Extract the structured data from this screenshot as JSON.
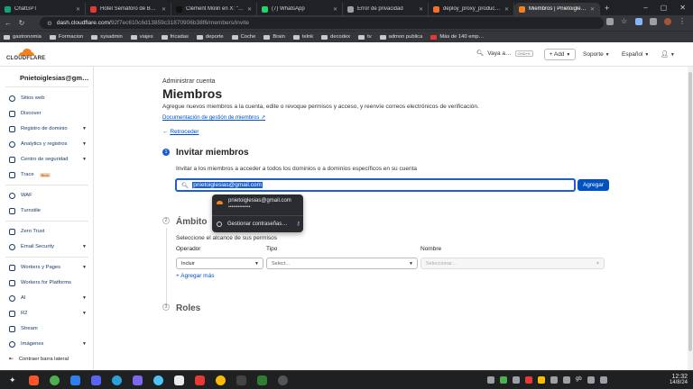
{
  "browser": {
    "tabs": [
      {
        "label": "ChatGPT",
        "color": "#10a37f"
      },
      {
        "label": "Hotel Semáforo de Bares",
        "color": "#e53935"
      },
      {
        "label": "Clément Molin en X: \"~Per…",
        "color": "#111111"
      },
      {
        "label": "(7) WhatsApp",
        "color": "#25d366"
      },
      {
        "label": "Error de privacidad",
        "color": "#9aa0a6"
      },
      {
        "label": "deploy_proxy_production",
        "color": "#fc6d26"
      },
      {
        "label": "Miembros | Pnietoiglesias…",
        "color": "#f48120",
        "active": true
      }
    ],
    "new_tab": "+",
    "url_host": "dash.cloudflare.com/",
    "url_path": "92f7ec610c6d13859c31870906b38f6/members/invite",
    "bookmarks": [
      "gastronomia",
      "Formacion",
      "sysadmin",
      "viajes",
      "fricadas",
      "deporte",
      "Coche",
      "Brain",
      "telnk",
      "decodex",
      "tv",
      "admon publica",
      "Más de 140 emp…"
    ]
  },
  "header": {
    "logo_text": "CLOUDFLARE",
    "search_label": "Vaya a…",
    "search_shortcut": "CMD+K",
    "add_label": "+ Add",
    "support_label": "Soporte",
    "language_label": "Español"
  },
  "sidebar": {
    "account_name": "Pnietoiglesias@gm…",
    "items": [
      {
        "label": "Sitios web",
        "chevron": false
      },
      {
        "label": "Discover",
        "chevron": false
      },
      {
        "label": "Registro de dominio",
        "chevron": true
      },
      {
        "label": "Analytics y registros",
        "chevron": true
      },
      {
        "label": "Centro de seguridad",
        "chevron": true
      },
      {
        "label": "Trace",
        "chevron": false,
        "badge": "Beta"
      },
      {
        "label": "WAF",
        "chevron": false
      },
      {
        "label": "Turnstile",
        "chevron": false
      },
      {
        "label": "Zero Trust",
        "chevron": false
      },
      {
        "label": "Email Security",
        "chevron": true
      },
      {
        "label": "Workers y Pages",
        "chevron": true
      },
      {
        "label": "Workers for Platforms",
        "chevron": false
      },
      {
        "label": "AI",
        "chevron": true
      },
      {
        "label": "R2",
        "chevron": true
      },
      {
        "label": "Stream",
        "chevron": false
      },
      {
        "label": "Imágenes",
        "chevron": true
      }
    ],
    "collapse_label": "Contraer barra lateral"
  },
  "main": {
    "breadcrumb": "Administrar cuenta",
    "title": "Miembros",
    "description": "Agregue nuevos miembros a la cuenta, edite o revoque permisos y acceso, y reenvíe correos electrónicos de verificación.",
    "doc_link": "Documentación de gestión de miembros",
    "back_label": "Retroceder",
    "step1": {
      "number": "1",
      "title": "Invitar miembros",
      "subtitle": "Invitar a los miembros a acceder a todos los dominios o a dominios específicos en su cuenta",
      "email_value": "pnietoiglesias@gmail.com",
      "add_button": "Agregar"
    },
    "autofill": {
      "email": "pnietoiglesias@gmail.com",
      "masked_password": "••••••••••••••",
      "manage_label": "Gestionar contraseñas…"
    },
    "step2": {
      "number": "2",
      "title": "Ámbito",
      "subtitle": "Seleccione el alcance de sus permisos",
      "col_operator": "Operador",
      "col_type": "Tipo",
      "col_name": "Nombre",
      "operator_value": "Incluir",
      "type_placeholder": "Select...",
      "name_placeholder": "Seleccionar…",
      "add_more": "+ Agregar más"
    },
    "step3": {
      "number": "3",
      "title": "Roles"
    }
  },
  "taskbar": {
    "time": "12:32",
    "date": "14/8/24",
    "lang": "gb"
  }
}
